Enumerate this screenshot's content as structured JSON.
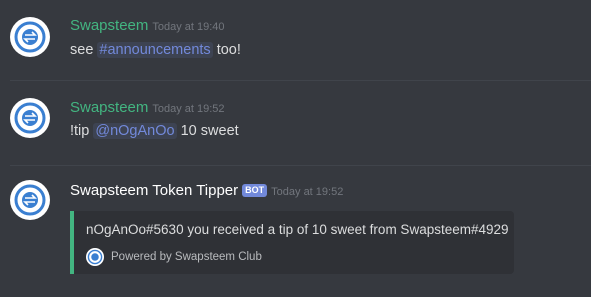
{
  "colors": {
    "background": "#36393f",
    "username": "#43b581",
    "mention": "#7289da",
    "embed_accent": "#43b581",
    "bot_tag": "#7289da",
    "logo": "#3a7fd1"
  },
  "messages": [
    {
      "author": "Swapsteem",
      "timestamp": "Today at 19:40",
      "text_before": "see ",
      "mention": "#announcements",
      "text_after": " too!",
      "avatar_icon": "swapsteem-logo-icon"
    },
    {
      "author": "Swapsteem",
      "timestamp": "Today at 19:52",
      "text_before": "!tip ",
      "mention": "@nOgAnOo",
      "text_after": " 10 sweet",
      "avatar_icon": "swapsteem-logo-icon"
    },
    {
      "author": "Swapsteem Token Tipper",
      "bot_tag": "BOT",
      "timestamp": "Today at 19:52",
      "avatar_icon": "swapsteem-logo-icon",
      "embed": {
        "description": "nOgAnOo#5630 you received a tip of 10 sweet from Swapsteem#4929",
        "footer": "Powered by Swapsteem Club",
        "footer_icon": "swapsteem-logo-icon"
      }
    }
  ]
}
